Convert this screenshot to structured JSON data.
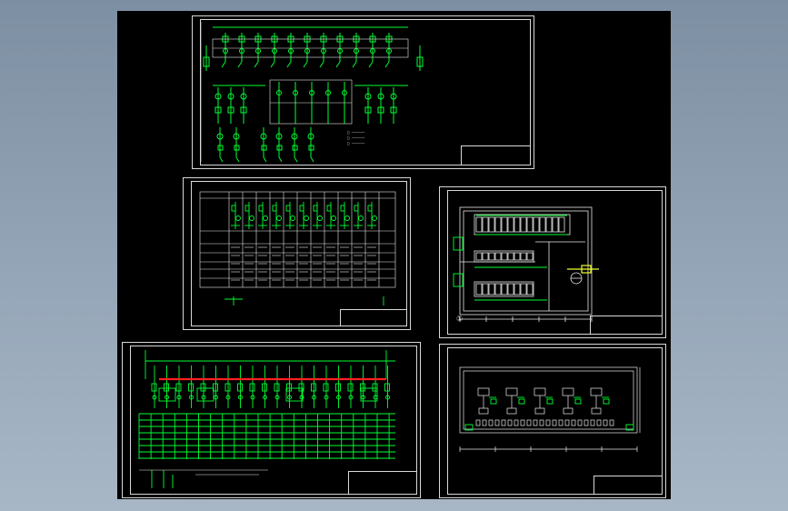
{
  "colors": {
    "background": "#8fa1b4",
    "viewport": "#000000",
    "sheet_border": "#d8d8d8",
    "schematic_green": "#00ff33",
    "busbar_red": "#ff2020",
    "linework_white": "#e8e8e8",
    "accent_yellow": "#f0ff30"
  },
  "sheets": {
    "main_wiring": {
      "kind": "single-line-diagram",
      "title_block": ""
    },
    "switchgear_table": {
      "kind": "switchgear-schedule",
      "title_block": ""
    },
    "floor_plan": {
      "kind": "substation-floor-plan",
      "room_label": "",
      "axis_marker": "①"
    },
    "panel_elevation": {
      "kind": "panel-layout-elevation"
    },
    "low_voltage_schedule": {
      "kind": "low-voltage-schedule"
    }
  }
}
